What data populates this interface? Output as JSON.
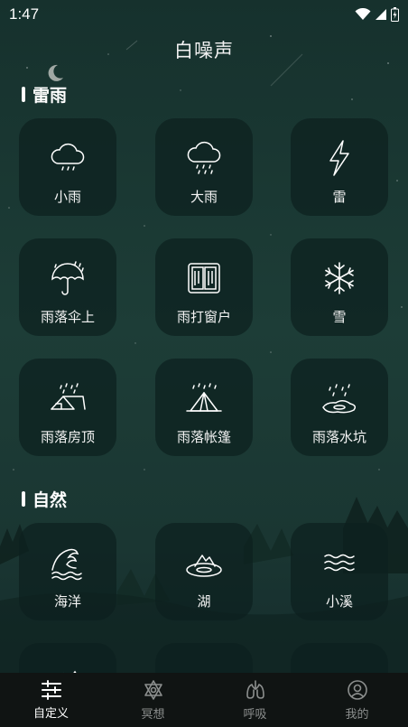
{
  "status_bar": {
    "time": "1:47",
    "icons": [
      "wifi-icon",
      "signal-icon",
      "battery-icon"
    ]
  },
  "header": {
    "title": "白噪声"
  },
  "sections": [
    {
      "label": "雷雨",
      "items": [
        {
          "label": "小雨",
          "icon": "light-rain-cloud-icon"
        },
        {
          "label": "大雨",
          "icon": "heavy-rain-cloud-icon"
        },
        {
          "label": "雷",
          "icon": "lightning-bolt-icon"
        },
        {
          "label": "雨落伞上",
          "icon": "umbrella-rain-icon"
        },
        {
          "label": "雨打窗户",
          "icon": "window-icon"
        },
        {
          "label": "雪",
          "icon": "snowflake-icon"
        },
        {
          "label": "雨落房顶",
          "icon": "roof-rain-icon"
        },
        {
          "label": "雨落帐篷",
          "icon": "tent-rain-icon"
        },
        {
          "label": "雨落水坑",
          "icon": "puddle-rain-icon"
        }
      ]
    },
    {
      "label": "自然",
      "items": [
        {
          "label": "海洋",
          "icon": "ocean-wave-icon"
        },
        {
          "label": "湖",
          "icon": "lake-icon"
        },
        {
          "label": "小溪",
          "icon": "stream-waves-icon"
        }
      ]
    }
  ],
  "bottom_nav": [
    {
      "label": "自定义",
      "icon": "sliders-icon",
      "active": true
    },
    {
      "label": "冥想",
      "icon": "meditation-star-icon",
      "active": false
    },
    {
      "label": "呼吸",
      "icon": "lungs-icon",
      "active": false
    },
    {
      "label": "我的",
      "icon": "user-profile-icon",
      "active": false
    }
  ],
  "colors": {
    "background": "#1d3d37",
    "tile": "#0c201e",
    "nav_background": "#101413",
    "nav_inactive": "#8c8f8e",
    "nav_active": "#ffffff"
  }
}
